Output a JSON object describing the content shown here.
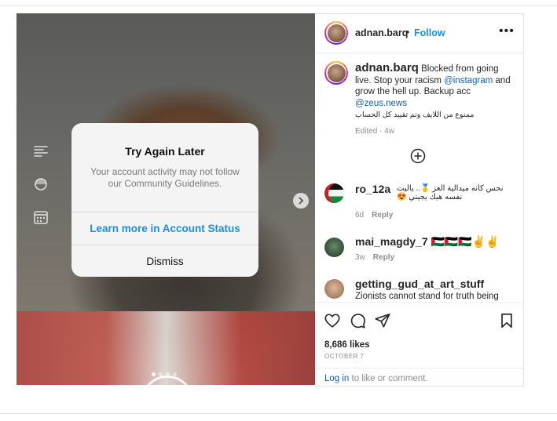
{
  "post": {
    "username": "adnan.barq",
    "bullet": "•",
    "follow_label": "Follow",
    "more_icon": "•••",
    "caption_pre": "Blocked from going live. Stop your racism ",
    "caption_mention1": "@instagram",
    "caption_mid": " and grow the hell up. Backup acc ",
    "caption_mention2": "@zeus.news",
    "caption_arabic": "ممنوع من اللايف وتم تقييد كل الحساب",
    "caption_meta": "Edited · 4w",
    "likes": "8,686 likes",
    "date": "OCTOBER 7",
    "login_link": "Log in",
    "login_rest": " to like or comment."
  },
  "dialog": {
    "title": "Try Again Later",
    "message": "Your account activity may not follow our Community Guidelines.",
    "primary": "Learn more in Account Status",
    "secondary": "Dismiss"
  },
  "comments": [
    {
      "username": "ro_12a",
      "text": "نحس كانه ميدالية العز 🥇.. ياليت نفسه هيك يجيني 😍",
      "time": "6d",
      "reply": "Reply"
    },
    {
      "username": "mai_magdy_7 🇵🇸🇵🇸🇵🇸✌️✌️",
      "time": "3w",
      "reply": "Reply"
    },
    {
      "username": "getting_gud_at_art_stuff",
      "text": "Zionists cannot stand for truth being"
    }
  ],
  "media": {
    "slides": 4,
    "active_slide": 1
  },
  "colors": {
    "accent": "#1a8fdd",
    "link": "#1a5fa0",
    "muted": "#8e8e8e"
  }
}
